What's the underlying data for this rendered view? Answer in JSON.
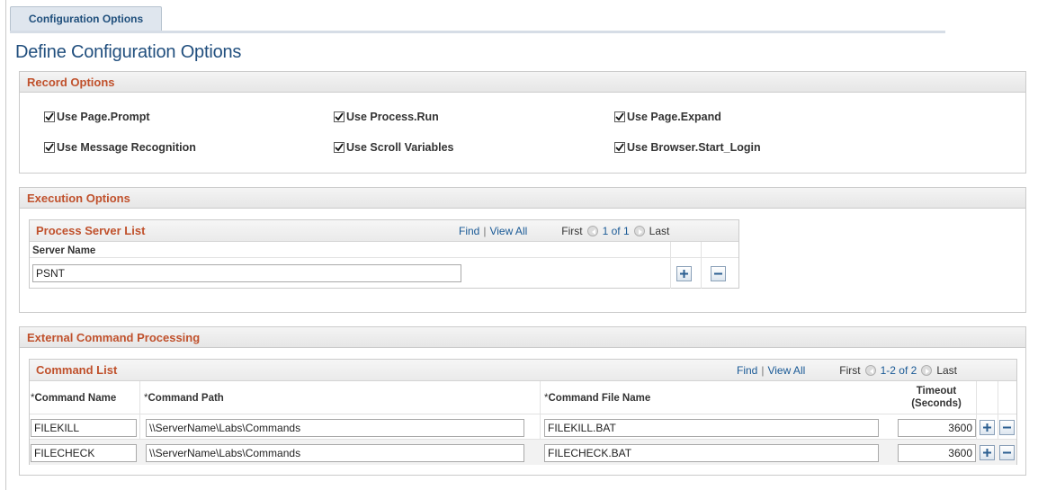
{
  "tab": {
    "label": "Configuration Options"
  },
  "page_title": "Define Configuration Options",
  "record_options": {
    "header": "Record Options",
    "checkboxes": [
      {
        "label": "Use Page.Prompt",
        "checked": true
      },
      {
        "label": "Use Process.Run",
        "checked": true
      },
      {
        "label": "Use Page.Expand",
        "checked": true
      },
      {
        "label": "Use Message Recognition",
        "checked": true
      },
      {
        "label": "Use Scroll Variables",
        "checked": true
      },
      {
        "label": "Use Browser.Start_Login",
        "checked": true
      }
    ]
  },
  "execution_options": {
    "header": "Execution Options",
    "grid": {
      "title": "Process Server List",
      "find": "Find",
      "view_all": "View All",
      "first": "First",
      "range": "1 of 1",
      "last": "Last",
      "column": "Server Name",
      "rows": [
        {
          "server_name": "PSNT"
        }
      ]
    }
  },
  "external_command": {
    "header": "External Command Processing",
    "grid": {
      "title": "Command List",
      "find": "Find",
      "view_all": "View All",
      "first": "First",
      "range": "1-2 of 2",
      "last": "Last",
      "columns": {
        "required_mark": "*",
        "name": "Command Name",
        "path": "Command Path",
        "file": "Command File Name",
        "timeout_line1": "Timeout",
        "timeout_line2": "(Seconds)"
      },
      "rows": [
        {
          "name": "FILEKILL",
          "path": "\\\\ServerName\\Labs\\Commands",
          "file": "FILEKILL.BAT",
          "timeout": "3600"
        },
        {
          "name": "FILECHECK",
          "path": "\\\\ServerName\\Labs\\Commands",
          "file": "FILECHECK.BAT",
          "timeout": "3600"
        }
      ]
    }
  },
  "icons": {
    "add": "plus-icon",
    "delete": "minus-icon",
    "prev": "previous-arrow-icon",
    "next": "next-arrow-icon",
    "check": "checkmark-icon"
  },
  "colors": {
    "section_header": "#c0512c",
    "title": "#214f7e",
    "link": "#1a5a96"
  }
}
